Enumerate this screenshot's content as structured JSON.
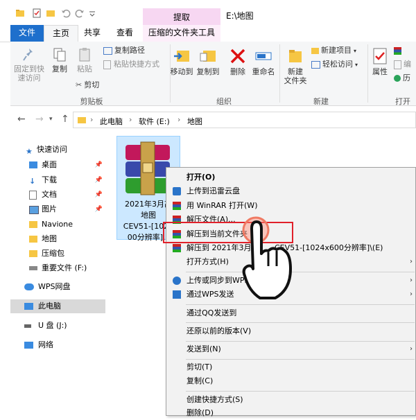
{
  "window": {
    "contextual_tab_label": "提取",
    "title": "E:\\地图"
  },
  "tabs": {
    "file": "文件",
    "home": "主页",
    "share": "共享",
    "view": "查看",
    "tools": "压缩的文件夹工具"
  },
  "ribbon": {
    "pin_quick_access": [
      "固定到快",
      "速访问"
    ],
    "copy": "复制",
    "paste": "粘贴",
    "copy_path": "复制路径",
    "paste_shortcut": "粘贴快捷方式",
    "cut": "剪切",
    "group_clipboard": "剪贴板",
    "move_to": "移动到",
    "copy_to": "复制到",
    "delete": "删除",
    "rename": "重命名",
    "group_organize": "组织",
    "new_folder": [
      "新建",
      "文件夹"
    ],
    "new_item": "新建项目",
    "easy_access": "轻松访问",
    "group_new": "新建",
    "properties": "属性",
    "edit": "编",
    "history": "历",
    "group_open": "打开"
  },
  "address": {
    "crumbs": [
      "此电脑",
      "软件 (E:)",
      "地图"
    ]
  },
  "nav": {
    "quick_access": "快速访问",
    "desktop": "桌面",
    "downloads": "下载",
    "documents": "文档",
    "pictures": "图片",
    "navione": "Navione",
    "map": "地图",
    "zip": "压缩包",
    "important": "重要文件 (F:)",
    "wps_drive": "WPS网盘",
    "this_pc": "此电脑",
    "usb": "U 盘 (J:)",
    "network": "网络"
  },
  "file": {
    "name_lines": [
      "2021年3月高",
      "地图",
      "CEV51-[1024",
      "00分辨率].z"
    ]
  },
  "context_menu": {
    "open": "打开(O)",
    "upload_xunlei": "上传到迅雷云盘",
    "open_winrar": "用 WinRAR 打开(W)",
    "extract_files": "解压文件(A)...",
    "extract_here": "解压到当前文件夹",
    "extract_to": "解压到 2021年3月",
    "extract_to_tail": "CEV51-[1024x600分辨率]\\(E)",
    "open_with": "打开方式(H)",
    "upload_wps": "上传或同步到WPS",
    "send_wps": "通过WPS发送",
    "send_qq": "通过QQ发送到",
    "restore": "还原以前的版本(V)",
    "send_to": "发送到(N)",
    "cut": "剪切(T)",
    "copy": "复制(C)",
    "create_shortcut": "创建快捷方式(S)",
    "delete": "删除(D)"
  },
  "colors": {
    "file_tab": "#1e6fcc",
    "contextual_tab": "#f7d7f2",
    "selection": "#cce8ff",
    "highlight_box": "#e0202a",
    "folder": "#f6c643"
  }
}
